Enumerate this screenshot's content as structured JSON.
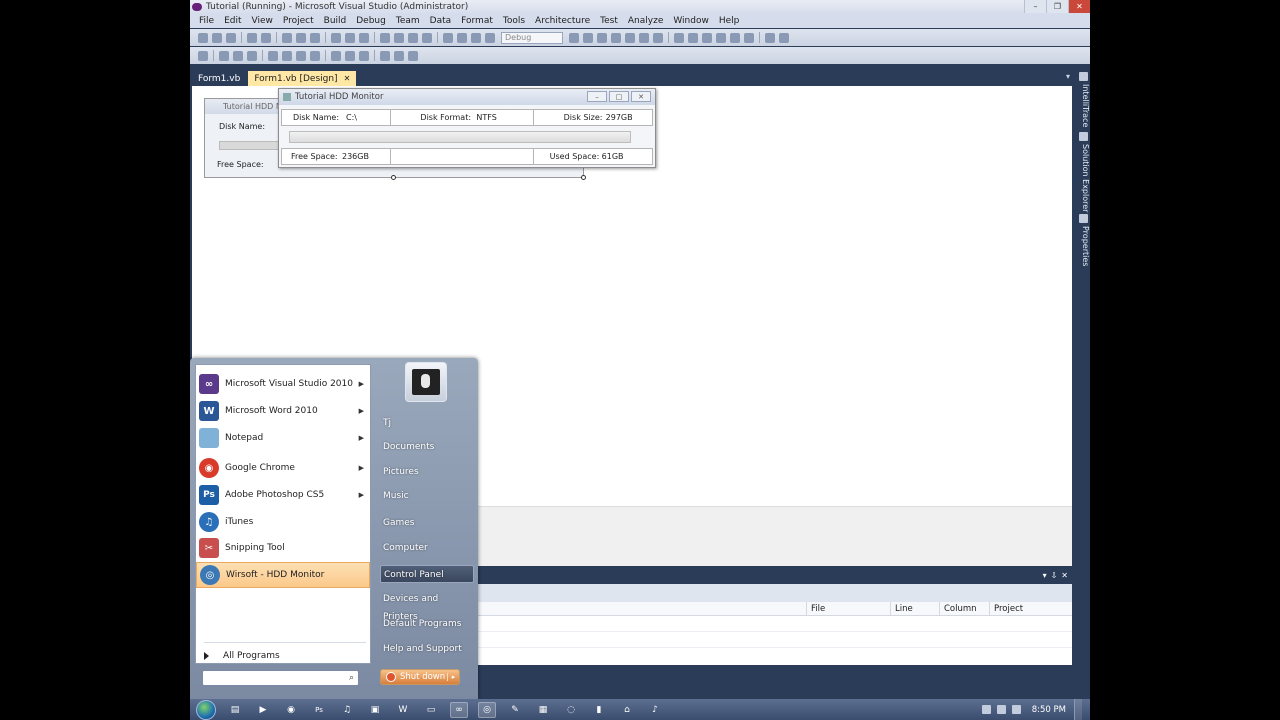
{
  "window": {
    "title": "Tutorial (Running) - Microsoft Visual Studio (Administrator)",
    "controls": [
      "–",
      "❐",
      "✕"
    ]
  },
  "menu": [
    "File",
    "Edit",
    "View",
    "Project",
    "Build",
    "Debug",
    "Team",
    "Data",
    "Format",
    "Tools",
    "Architecture",
    "Test",
    "Analyze",
    "Window",
    "Help"
  ],
  "toolbar": {
    "config_value": "Debug"
  },
  "doc_tabs": [
    {
      "label": "Form1.vb",
      "active": false
    },
    {
      "label": "Form1.vb [Design]",
      "active": true,
      "close": "✕"
    }
  ],
  "tab_dropdown": "▾",
  "right_rail": [
    "IntelliTrace",
    "Solution Explorer",
    "Properties"
  ],
  "designer_form": {
    "title": "Tutorial HDD M",
    "disk_name_label": "Disk Name:",
    "free_space_label": "Free Space:"
  },
  "running_form": {
    "title": "Tutorial HDD Monitor",
    "buttons": [
      "–",
      "□",
      "✕"
    ],
    "disk_name_label": "Disk Name:",
    "disk_name_value": "C:\\",
    "disk_format_label": "Disk Format:",
    "disk_format_value": "NTFS",
    "disk_size_label": "Disk Size:",
    "disk_size_value": "297GB",
    "free_space_label": "Free Space:",
    "free_space_value": "236GB",
    "used_space_label": "Used Space:",
    "used_space_value": "61GB"
  },
  "error_list": {
    "header_buttons": [
      "▾",
      "⇩",
      "✕"
    ],
    "columns": [
      "File",
      "Line",
      "Column",
      "Project"
    ]
  },
  "start_menu": {
    "programs": [
      {
        "label": "Microsoft Visual Studio 2010",
        "icon": "visual-studio-icon",
        "has_arrow": true,
        "color": "#5b3a8c",
        "glyph": "∞"
      },
      {
        "label": "Microsoft Word 2010",
        "icon": "word-icon",
        "has_arrow": true,
        "color": "#2b5797",
        "glyph": "W"
      },
      {
        "label": "Notepad",
        "icon": "notepad-icon",
        "has_arrow": true,
        "color": "#7fb2d6",
        "glyph": ""
      },
      {
        "label": "Google Chrome",
        "icon": "chrome-icon",
        "has_arrow": true,
        "color": "#d93b2b",
        "glyph": "◉"
      },
      {
        "label": "Adobe Photoshop CS5",
        "icon": "photoshop-icon",
        "has_arrow": true,
        "color": "#1d5fa6",
        "glyph": "Ps"
      },
      {
        "label": "iTunes",
        "icon": "itunes-icon",
        "has_arrow": false,
        "color": "#2a6fb8",
        "glyph": "♫"
      },
      {
        "label": "Snipping Tool",
        "icon": "scissors-icon",
        "has_arrow": false,
        "color": "#c94f4f",
        "glyph": "✂"
      },
      {
        "label": "Wirsoft - HDD Monitor",
        "icon": "hdd-monitor-icon",
        "has_arrow": false,
        "color": "#3c79b4",
        "glyph": "◎",
        "highlight": true
      }
    ],
    "arrow_glyph": "▶",
    "all_programs": "All Programs",
    "search_placeholder": "",
    "search_glyph": "⌕",
    "right_links": [
      "Tj",
      "Documents",
      "Pictures",
      "Music",
      "Games",
      "Computer",
      "Control Panel",
      "Devices and Printers",
      "Default Programs",
      "Help and Support"
    ],
    "right_highlight": "Control Panel",
    "shutdown_label": "Shut down",
    "shutdown_arrow": "▸"
  },
  "taskbar": {
    "apps": [
      {
        "icon": "windows-explorer-icon",
        "glyph": "▤",
        "active": false
      },
      {
        "icon": "media-player-icon",
        "glyph": "▶",
        "active": false
      },
      {
        "icon": "chrome-icon",
        "glyph": "◉",
        "active": false
      },
      {
        "icon": "photoshop-icon",
        "glyph": "Ps",
        "active": false
      },
      {
        "icon": "itunes-icon",
        "glyph": "♫",
        "active": false
      },
      {
        "icon": "folder-icon",
        "glyph": "▣",
        "active": false
      },
      {
        "icon": "word-icon",
        "glyph": "W",
        "active": false
      },
      {
        "icon": "notepad-icon",
        "glyph": "▭",
        "active": false
      },
      {
        "icon": "visual-studio-icon",
        "glyph": "∞",
        "active": true
      },
      {
        "icon": "hdd-monitor-icon",
        "glyph": "◎",
        "active": true
      },
      {
        "icon": "paint-icon",
        "glyph": "✎",
        "active": false
      },
      {
        "icon": "calculator-icon",
        "glyph": "▦",
        "active": false
      },
      {
        "icon": "explorer-icon",
        "glyph": "◌",
        "active": false
      },
      {
        "icon": "terminal-icon",
        "glyph": "▮",
        "active": false
      },
      {
        "icon": "network-icon",
        "glyph": "⌂",
        "active": false
      },
      {
        "icon": "volume-icon",
        "glyph": "♪",
        "active": false
      }
    ],
    "clock": "8:50 PM"
  }
}
